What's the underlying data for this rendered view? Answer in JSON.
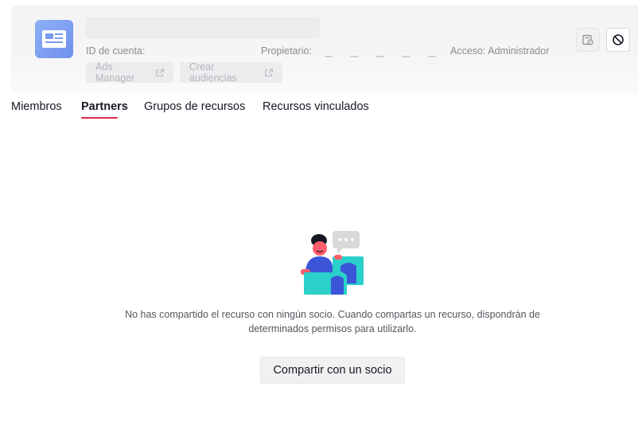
{
  "header": {
    "account_id_label": "ID de cuenta:",
    "owner_label": "Propietario:",
    "access_label": "Acceso: Administrador",
    "ads_manager_label": "Ads Manager",
    "create_audiences_label": "Crear audiencias"
  },
  "tabs": [
    {
      "label": "Miembros"
    },
    {
      "label": "Partners"
    },
    {
      "label": "Grupos de recursos"
    },
    {
      "label": "Recursos vinculados"
    }
  ],
  "active_tab": "Partners",
  "empty_state": {
    "message": "No has compartido el recurso con ningún socio. Cuando compartas un recurso, dispondrán de determinados permisos para utilizarlo.",
    "button_label": "Compartir con un socio"
  },
  "colors": {
    "accent": "#e0264f",
    "avatar": "#7b9bf0"
  },
  "icons": {
    "avatar": "account-card-icon",
    "external": "external-link-icon",
    "settings": "calendar-settings-icon",
    "block": "block-icon"
  }
}
